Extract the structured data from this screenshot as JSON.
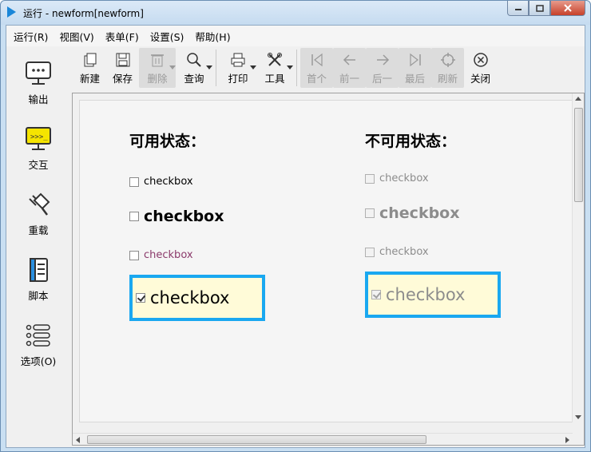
{
  "window": {
    "title": "运行 - newform[newform]"
  },
  "menu": [
    "运行(R)",
    "视图(V)",
    "表单(F)",
    "设置(S)",
    "帮助(H)"
  ],
  "toolbar": {
    "new": "新建",
    "save": "保存",
    "delete": "删除",
    "query": "查询",
    "print": "打印",
    "tools": "工具",
    "first": "首个",
    "prev": "前一",
    "next": "后一",
    "last": "最后",
    "refresh": "刷新",
    "close": "关闭"
  },
  "sidebar": {
    "output": "输出",
    "interact": "交互",
    "reload": "重载",
    "script": "脚本",
    "options": "选项(O)"
  },
  "form": {
    "enabled_heading": "可用状态：",
    "disabled_heading": "不可用状态：",
    "cb_label": "checkbox",
    "enabled": [
      {
        "label": "checkbox",
        "checked": false
      },
      {
        "label": "checkbox",
        "checked": false
      },
      {
        "label": "checkbox",
        "checked": false,
        "color": "#8b3a6b"
      },
      {
        "label": "checkbox",
        "checked": true
      }
    ],
    "disabled": [
      {
        "label": "checkbox",
        "checked": false
      },
      {
        "label": "checkbox",
        "checked": false
      },
      {
        "label": "checkbox",
        "checked": false
      },
      {
        "label": "checkbox",
        "checked": true
      }
    ]
  },
  "colors": {
    "highlight_border": "#1aa8f0",
    "highlight_bg": "#fffbd8",
    "disabled_text": "#8c8c8c",
    "purple_text": "#8b3a6b"
  }
}
